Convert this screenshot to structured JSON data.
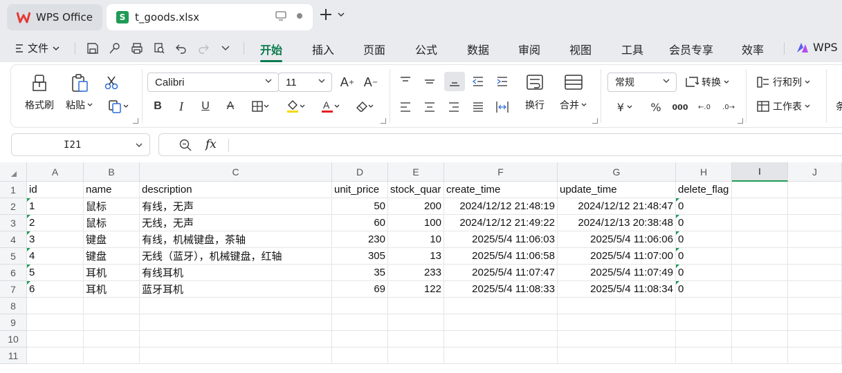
{
  "tabs": {
    "home_label": "WPS Office",
    "file_label": "t_goods.xlsx",
    "sheet_glyph": "S"
  },
  "menu": {
    "file_label": "文件",
    "items": [
      "开始",
      "插入",
      "页面",
      "公式",
      "数据",
      "审阅",
      "视图",
      "工具",
      "会员专享",
      "效率",
      "WPS"
    ],
    "active": "开始"
  },
  "ribbon": {
    "format_painter": "格式刷",
    "paste": "粘贴",
    "font_name": "Calibri",
    "font_size": "11",
    "wrap": "换行",
    "merge": "合并",
    "number_format": "常规",
    "convert": "转换",
    "rows_cols": "行和列",
    "worksheet": "工作表",
    "currency_glyph": "¥",
    "percent_glyph": "%",
    "thousands_glyph": "000",
    "cut_off_label": "条"
  },
  "formula_bar": {
    "cell_ref": "I21",
    "fx_label": "fx",
    "formula": ""
  },
  "grid": {
    "columns": [
      "A",
      "B",
      "C",
      "D",
      "E",
      "F",
      "G",
      "H",
      "I",
      "J"
    ],
    "selected_column": "I",
    "row_numbers": [
      "1",
      "2",
      "3",
      "4",
      "5",
      "6",
      "7",
      "8",
      "9",
      "10",
      "11"
    ],
    "header_row": [
      "id",
      "name",
      "description",
      "unit_price",
      "stock_quar",
      "create_time",
      "update_time",
      "delete_flag"
    ],
    "rows": [
      [
        "1",
        "鼠标",
        "有线，无声",
        "50",
        "200",
        "2024/12/12 21:48:19",
        "2024/12/12 21:48:47",
        "0"
      ],
      [
        "2",
        "鼠标",
        "无线，无声",
        "60",
        "100",
        "2024/12/12 21:49:22",
        "2024/12/13 20:38:48",
        "0"
      ],
      [
        "3",
        "键盘",
        "有线，机械键盘，茶轴",
        "230",
        "10",
        "2025/5/4 11:06:03",
        "2025/5/4 11:06:06",
        "0"
      ],
      [
        "4",
        "键盘",
        "无线（蓝牙），机械键盘，红轴",
        "305",
        "13",
        "2025/5/4 11:06:58",
        "2025/5/4 11:07:00",
        "0"
      ],
      [
        "5",
        "耳机",
        "有线耳机",
        "35",
        "233",
        "2025/5/4 11:07:47",
        "2025/5/4 11:07:49",
        "0"
      ],
      [
        "6",
        "耳机",
        "蓝牙耳机",
        "69",
        "122",
        "2025/5/4 11:08:33",
        "2025/5/4 11:08:34",
        "0"
      ]
    ]
  },
  "colors": {
    "accent": "#0c7a4d",
    "sheet_green": "#1f9b55",
    "wps_red": "#e53935"
  }
}
